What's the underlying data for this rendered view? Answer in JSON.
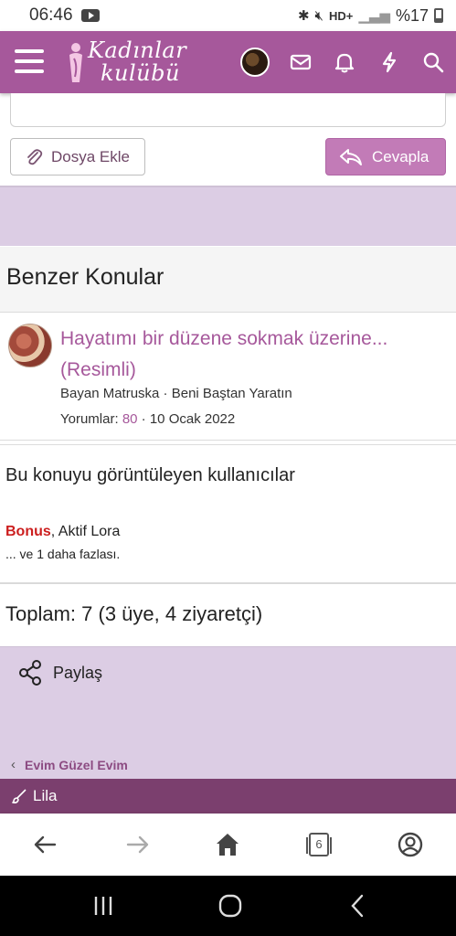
{
  "status_bar": {
    "time": "06:46",
    "network": "HD+",
    "battery": "%17",
    "icons": [
      "youtube-icon",
      "bluetooth-icon",
      "mute-icon",
      "wifi-icon",
      "signal-icon",
      "battery-icon"
    ]
  },
  "header": {
    "logo_line1": "Kadınlar",
    "logo_line2": "kulübü",
    "icons": [
      "menu-icon",
      "user-avatar",
      "mail-icon",
      "bell-icon",
      "lightning-icon",
      "search-icon"
    ]
  },
  "reply_form": {
    "attach_label": "Dosya Ekle",
    "reply_label": "Cevapla"
  },
  "similar_threads": {
    "heading": "Benzer Konular",
    "items": [
      {
        "title": "Hayatımı bir düzene sokmak üzerine... (Resimli)",
        "author": "Bayan Matruska",
        "forum": "Beni Baştan Yaratın",
        "replies_label": "Yorumlar:",
        "replies": "80",
        "date": "10 Ocak 2022"
      }
    ]
  },
  "viewers": {
    "heading": "Bu konuyu görüntüleyen kullanıcılar",
    "user1": "Bonus",
    "user2": ", Aktif Lora",
    "more": "... ve 1 daha fazlası."
  },
  "totals": {
    "text": "Toplam: 7 (3 üye, 4 ziyaretçi)"
  },
  "share": {
    "label": "Paylaş"
  },
  "breadcrumb": {
    "label": "Evim Güzel Evim"
  },
  "style_bar": {
    "label": "Lila"
  },
  "browser_nav": {
    "tab_count": "6"
  },
  "colors": {
    "brand": "#a6589b",
    "accent": "#c27bb7",
    "band": "#dccde4",
    "style_bar": "#7b3f6e"
  }
}
